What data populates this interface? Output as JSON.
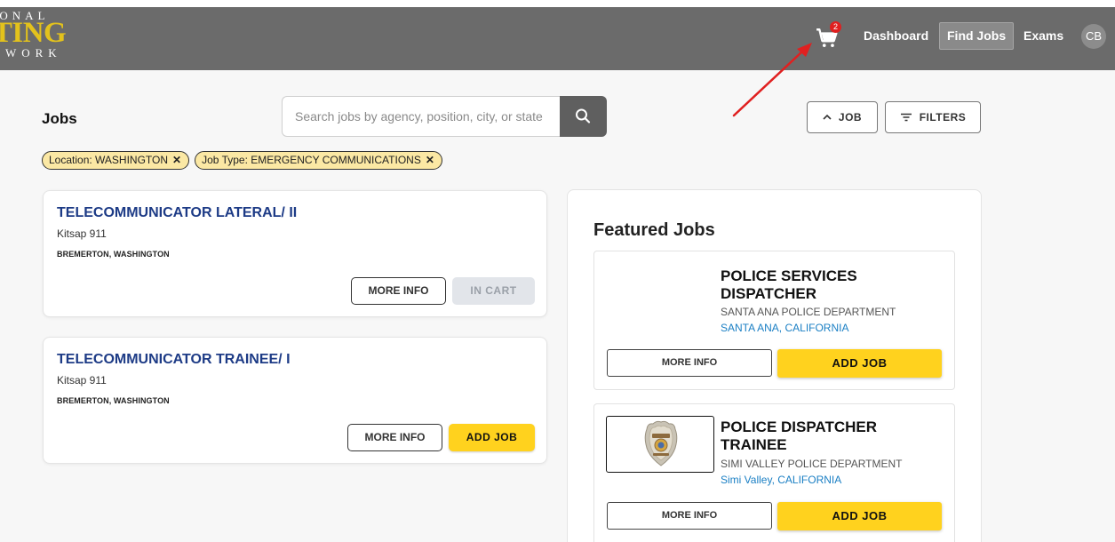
{
  "header": {
    "logo": {
      "line1": "IONAL",
      "line2": "STING",
      "line3": "TWORK"
    },
    "cart_count": "2",
    "nav": [
      "Dashboard",
      "Find Jobs",
      "Exams"
    ],
    "active_nav": "Find Jobs",
    "avatar_initials": "CB",
    "bg_color": "#6b6b6b",
    "logo_color": "#e3c21c"
  },
  "toolbar": {
    "title": "Jobs",
    "search_placeholder": "Search jobs by agency, position, city, or state",
    "job_toggle_label": "JOB",
    "filters_label": "FILTERS"
  },
  "filters": [
    {
      "label": "Location: WASHINGTON"
    },
    {
      "label": "Job Type: EMERGENCY COMMUNICATIONS"
    }
  ],
  "jobs": [
    {
      "title": "TELECOMMUNICATOR LATERAL/ II",
      "agency": "Kitsap 911",
      "location": "BREMERTON, WASHINGTON",
      "more_info_label": "MORE INFO",
      "action_label": "IN CART",
      "in_cart": true
    },
    {
      "title": "TELECOMMUNICATOR TRAINEE/ I",
      "agency": "Kitsap 911",
      "location": "BREMERTON, WASHINGTON",
      "more_info_label": "MORE INFO",
      "action_label": "ADD JOB",
      "in_cart": false
    }
  ],
  "featured": {
    "heading": "Featured Jobs",
    "items": [
      {
        "title": "POLICE SERVICES DISPATCHER",
        "agency": "SANTA ANA POLICE DEPARTMENT",
        "location": "SANTA ANA, CALIFORNIA",
        "more_info_label": "MORE INFO",
        "add_label": "ADD JOB"
      },
      {
        "title": "POLICE DISPATCHER TRAINEE",
        "agency": "SIMI VALLEY POLICE DEPARTMENT",
        "location": "Simi Valley, CALIFORNIA",
        "more_info_label": "MORE INFO",
        "add_label": "ADD JOB",
        "icon": "police-badge-icon"
      }
    ]
  },
  "colors": {
    "accent_yellow": "#ffd21e",
    "title_blue": "#1d3b86",
    "link_blue": "#1a7fc4",
    "chip_bg": "#fbe8a4",
    "annotation_red": "#e02020"
  }
}
